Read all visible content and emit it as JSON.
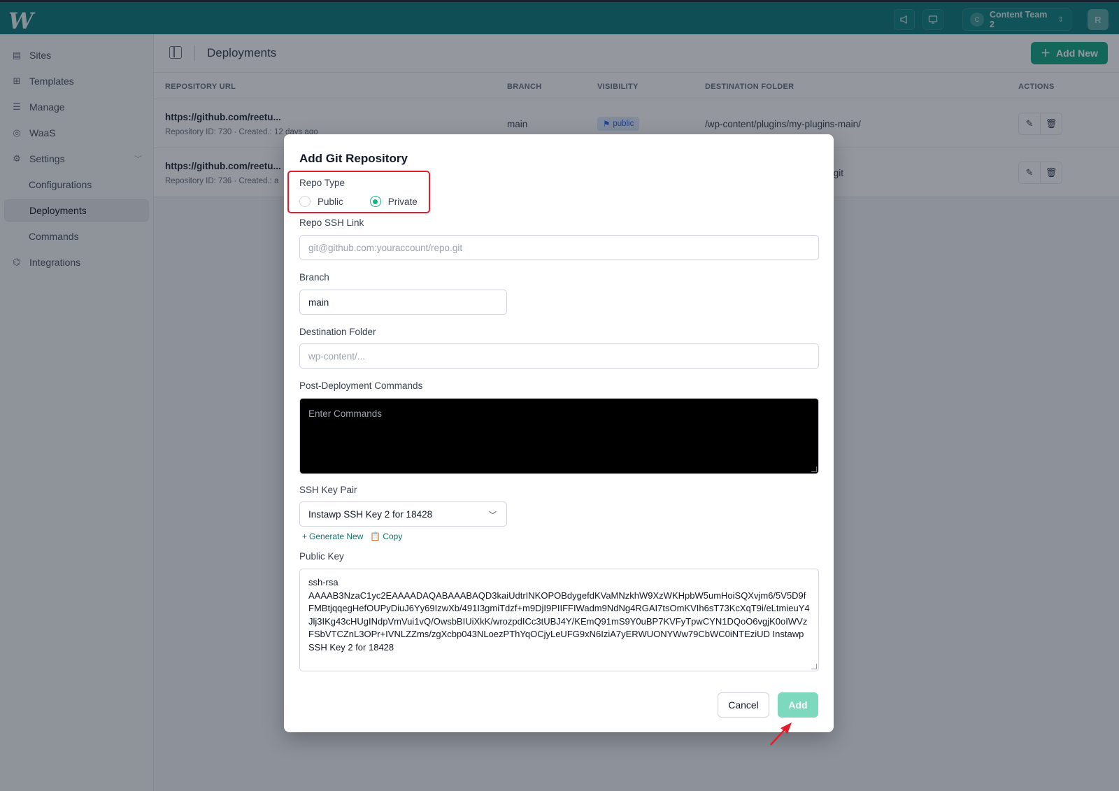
{
  "topbar": {
    "logo": "W",
    "team": {
      "avatar": "C",
      "name": "Content Team 2"
    },
    "user_avatar": "R"
  },
  "sidebar": {
    "items": [
      {
        "label": "Sites",
        "icon": "sites-icon"
      },
      {
        "label": "Templates",
        "icon": "templates-icon"
      },
      {
        "label": "Manage",
        "icon": "manage-icon"
      },
      {
        "label": "WaaS",
        "icon": "waas-icon"
      },
      {
        "label": "Settings",
        "icon": "gear-icon"
      },
      {
        "label": "Configurations"
      },
      {
        "label": "Deployments"
      },
      {
        "label": "Commands"
      },
      {
        "label": "Integrations",
        "icon": "integrations-icon"
      }
    ]
  },
  "header": {
    "title": "Deployments",
    "add_new_label": "Add New"
  },
  "table": {
    "columns": [
      "REPOSITORY URL",
      "BRANCH",
      "VISIBILITY",
      "DESTINATION FOLDER",
      "ACTIONS"
    ],
    "rows": [
      {
        "url": "https://github.com/reetu...",
        "meta": "Repository ID: 730  ·  Created.: 12 days ago",
        "branch": "main",
        "visibility": "public",
        "destination": "/wp-content/plugins/my-plugins-main/"
      },
      {
        "url": "https://github.com/reetu...",
        "meta": "Repository ID: 736  ·  Created.: a",
        "branch": "",
        "visibility": "",
        "destination": ".git"
      }
    ]
  },
  "modal": {
    "title": "Add Git Repository",
    "repo_type": {
      "label": "Repo Type",
      "options": [
        "Public",
        "Private"
      ],
      "selected": "Private"
    },
    "ssh_link": {
      "label": "Repo SSH Link",
      "placeholder": "git@github.com:youraccount/repo.git"
    },
    "branch": {
      "label": "Branch",
      "value": "main"
    },
    "destination": {
      "label": "Destination Folder",
      "placeholder": "wp-content/..."
    },
    "commands": {
      "label": "Post-Deployment Commands",
      "placeholder": "Enter Commands"
    },
    "ssh_key": {
      "label": "SSH Key Pair",
      "selected": "Instawp SSH Key 2 for 18428",
      "generate_label": "Generate New",
      "copy_label": "Copy"
    },
    "public_key": {
      "label": "Public Key",
      "value": "ssh-rsa\nAAAAB3NzaC1yc2EAAAADAQABAAABAQD3kaiUdtrINKOPOBdygefdKVaMNzkhW9XzWKHpbW5umHoiSQXvjm6/5V5D9fFMBtjqqegHefOUPyDiuJ6Yy69IzwXb/491I3gmiTdzf+m9DjI9PIIFFIWadm9NdNg4RGAI7tsOmKVIh6sT73KcXqT9i/eLtmieuY4Jlj3IKg43cHUgINdpVmVui1vQ/OwsbBIUiXkK/wrozpdICc3tUBJ4Y/KEmQ91mS9Y0uBP7KVFyTpwCYN1DQoO6vgjK0oIWVzFSbVTCZnL3OPr+IVNLZZms/zgXcbp043NLoezPThYqOCjyLeUFG9xN6IziA7yERWUONYWw79CbWC0iNTEziUD Instawp SSH Key 2 for 18428"
    },
    "buttons": {
      "cancel": "Cancel",
      "add": "Add"
    }
  },
  "colors": {
    "topbar": "#0c7b78",
    "accent": "#14a884",
    "highlight": "#e11d2e"
  }
}
